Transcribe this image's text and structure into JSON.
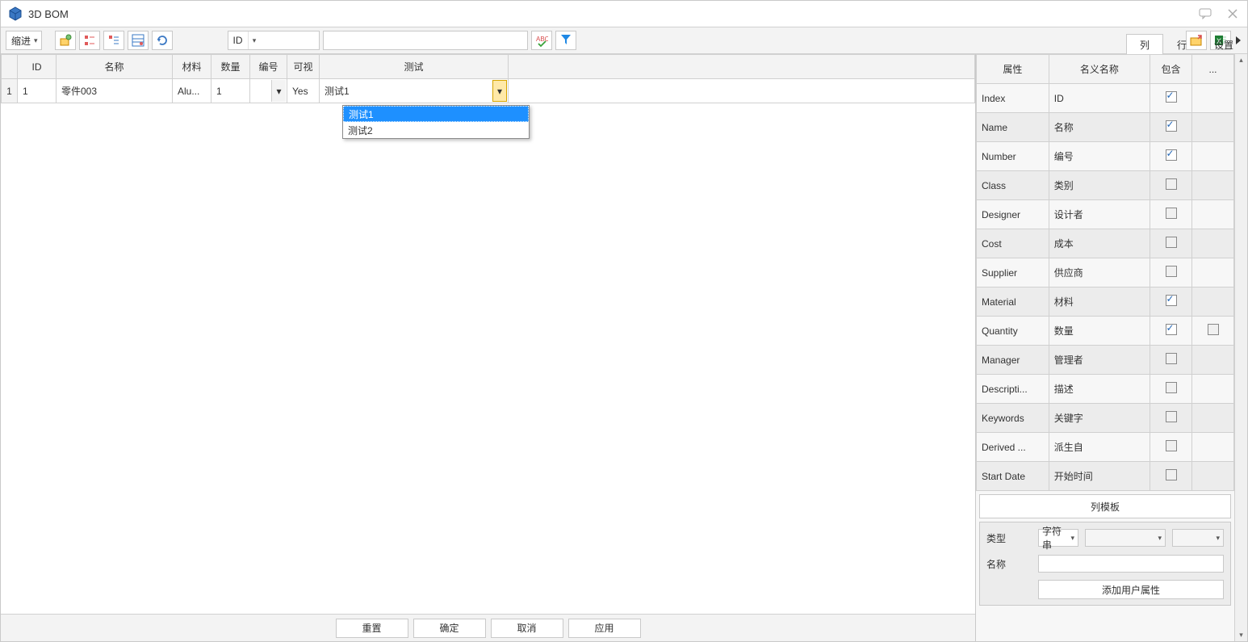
{
  "window": {
    "title": "3D BOM"
  },
  "toolbar": {
    "indent_label": "缩进",
    "id_combo": "ID",
    "search_placeholder": ""
  },
  "grid": {
    "headers": {
      "rownum": "",
      "id": "ID",
      "name": "名称",
      "material": "材料",
      "qty": "数量",
      "number": "编号",
      "visible": "可视",
      "test": "测试"
    },
    "rows": [
      {
        "rownum": "1",
        "id": "1",
        "name": "零件003",
        "material": "Alu...",
        "qty": "1",
        "number": "",
        "visible": "Yes",
        "test": "测试1"
      }
    ],
    "test_dropdown": {
      "options": [
        "测试1",
        "测试2"
      ],
      "selected_index": 0
    }
  },
  "tabs": {
    "col": "列",
    "row": "行",
    "settings": "设置"
  },
  "props": {
    "headers": {
      "attr": "属性",
      "nominal": "名义名称",
      "include": "包含",
      "extra": "..."
    },
    "rows": [
      {
        "attr": "Index",
        "nominal": "ID",
        "include": true,
        "extra": null
      },
      {
        "attr": "Name",
        "nominal": "名称",
        "include": true,
        "extra": null
      },
      {
        "attr": "Number",
        "nominal": "编号",
        "include": true,
        "extra": null
      },
      {
        "attr": "Class",
        "nominal": "类别",
        "include": false,
        "extra": null
      },
      {
        "attr": "Designer",
        "nominal": "设计者",
        "include": false,
        "extra": null
      },
      {
        "attr": "Cost",
        "nominal": "成本",
        "include": false,
        "extra": null
      },
      {
        "attr": "Supplier",
        "nominal": "供应商",
        "include": false,
        "extra": null
      },
      {
        "attr": "Material",
        "nominal": "材料",
        "include": true,
        "extra": null
      },
      {
        "attr": "Quantity",
        "nominal": "数量",
        "include": true,
        "extra": false
      },
      {
        "attr": "Manager",
        "nominal": "管理者",
        "include": false,
        "extra": null
      },
      {
        "attr": "Descripti...",
        "nominal": "描述",
        "include": false,
        "extra": null
      },
      {
        "attr": "Keywords",
        "nominal": "关键字",
        "include": false,
        "extra": null
      },
      {
        "attr": "Derived ...",
        "nominal": "派生自",
        "include": false,
        "extra": null
      },
      {
        "attr": "Start Date",
        "nominal": "开始时间",
        "include": false,
        "extra": null
      }
    ],
    "template_btn": "列模板"
  },
  "add_panel": {
    "type_label": "类型",
    "name_label": "名称",
    "type_value": "字符串",
    "add_btn": "添加用户属性"
  },
  "footer": {
    "reset": "重置",
    "ok": "确定",
    "cancel": "取消",
    "apply": "应用"
  }
}
